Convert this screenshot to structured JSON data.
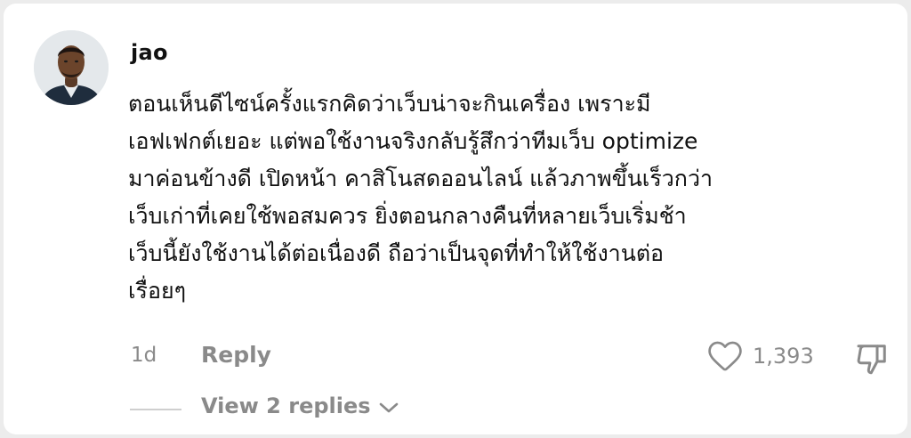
{
  "comment": {
    "username": "jao",
    "text": "ตอนเห็นดีไซน์ครั้งแรกคิดว่าเว็บน่าจะกินเครื่อง เพราะมี\nเอฟเฟกต์เยอะ แต่พอใช้งานจริงกลับรู้สึกว่าทีมเว็บ optimize\nมาค่อนข้างดี เปิดหน้า คาสิโนสดออนไลน์ แล้วภาพขึ้นเร็วกว่า\nเว็บเก่าที่เคยใช้พอสมควร ยิ่งตอนกลางคืนที่หลายเว็บเริ่มช้า\nเว็บนี้ยังใช้งานได้ต่อเนื่องดี ถือว่าเป็นจุดที่ทำให้ใช้งานต่อ\nเรื่อยๆ",
    "time": "1d",
    "reply_label": "Reply",
    "like_count": "1,393",
    "view_replies_label": "View 2 replies"
  },
  "icons": {
    "avatar": "user-avatar",
    "like": "heart-icon",
    "dislike": "thumbs-down-icon",
    "expand": "chevron-down-icon"
  },
  "colors": {
    "text": "#111111",
    "muted": "#8a8a8a",
    "background": "#ececec",
    "card": "#ffffff"
  }
}
